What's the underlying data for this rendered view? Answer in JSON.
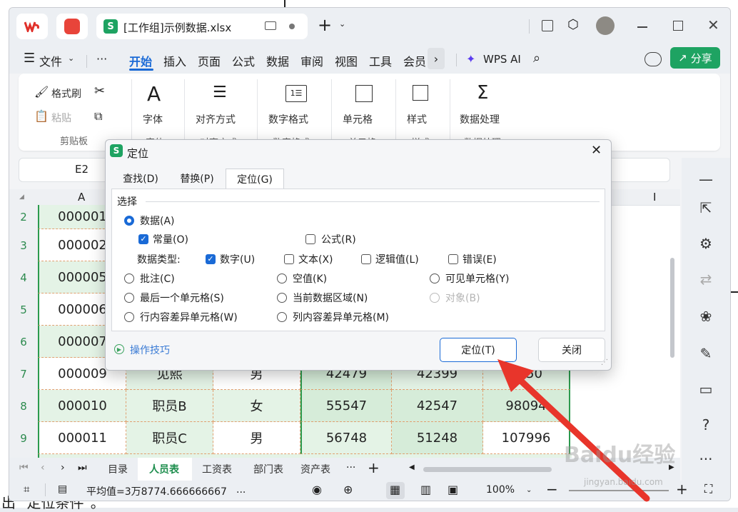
{
  "tabs": {
    "doc_title": "[工作组]示例数据.xlsx",
    "s_letter": "S"
  },
  "menu": {
    "file": "文件",
    "more": "···",
    "items": [
      "开始",
      "插入",
      "页面",
      "公式",
      "数据",
      "审阅",
      "视图",
      "工具",
      "会员"
    ],
    "wps_ai": "WPS AI",
    "share": "分享"
  },
  "ribbon": {
    "format_painter": "格式刷",
    "paste": "粘贴",
    "clipboard_group": "剪贴板",
    "font": "字体",
    "font_group": "字体",
    "align": "对齐方式",
    "align_group": "对齐方式",
    "number_format": "数字格式",
    "number_group": "数字格式",
    "cells": "单元格",
    "cells_group": "单元格",
    "styles": "样式",
    "styles_group": "样式",
    "data_process": "数据处理",
    "data_group": "数据处理"
  },
  "formula_bar": {
    "cell_ref": "E2"
  },
  "sheet": {
    "col_a": "A",
    "col_i": "I",
    "rows": [
      {
        "num": "2",
        "cells": [
          "000001"
        ]
      },
      {
        "num": "3",
        "cells": [
          "000002"
        ]
      },
      {
        "num": "4",
        "cells": [
          "000005"
        ]
      },
      {
        "num": "5",
        "cells": [
          "000006"
        ]
      },
      {
        "num": "6",
        "cells": [
          "000007"
        ]
      },
      {
        "num": "7",
        "cells": [
          "000009",
          "见熙",
          "男",
          "42479",
          "42399",
          "4750"
        ]
      },
      {
        "num": "8",
        "cells": [
          "000010",
          "职员B",
          "女",
          "55547",
          "42547",
          "98094"
        ]
      },
      {
        "num": "9",
        "cells": [
          "000011",
          "职员C",
          "男",
          "56748",
          "51248",
          "107996"
        ]
      }
    ]
  },
  "sheet_tabs": [
    "目录",
    "人员表",
    "工资表",
    "部门表",
    "资产表"
  ],
  "status": {
    "average": "平均值=3万8774.666666667",
    "ellipsis": "...",
    "zoom": "100%"
  },
  "dialog": {
    "title": "定位",
    "tab_find": "查找(D)",
    "tab_replace": "替换(P)",
    "tab_goto": "定位(G)",
    "section": "选择",
    "opt_data": "数据(A)",
    "opt_constant": "常量(O)",
    "opt_formula": "公式(R)",
    "data_type_label": "数据类型:",
    "opt_number": "数字(U)",
    "opt_text": "文本(X)",
    "opt_logical": "逻辑值(L)",
    "opt_error": "错误(E)",
    "opt_comment": "批注(C)",
    "opt_blank": "空值(K)",
    "opt_visible": "可见单元格(Y)",
    "opt_last_cell": "最后一个单元格(S)",
    "opt_current_region": "当前数据区域(N)",
    "opt_object": "对象(B)",
    "opt_row_diff": "行内容差异单元格(W)",
    "opt_col_diff": "列内容差异单元格(M)",
    "tips": "操作技巧",
    "goto_btn": "定位(T)",
    "close_btn": "关闭"
  },
  "colors": {
    "accent_green": "#1ea362",
    "accent_blue": "#1a6ad6",
    "arrow_red": "#e8352b"
  }
}
